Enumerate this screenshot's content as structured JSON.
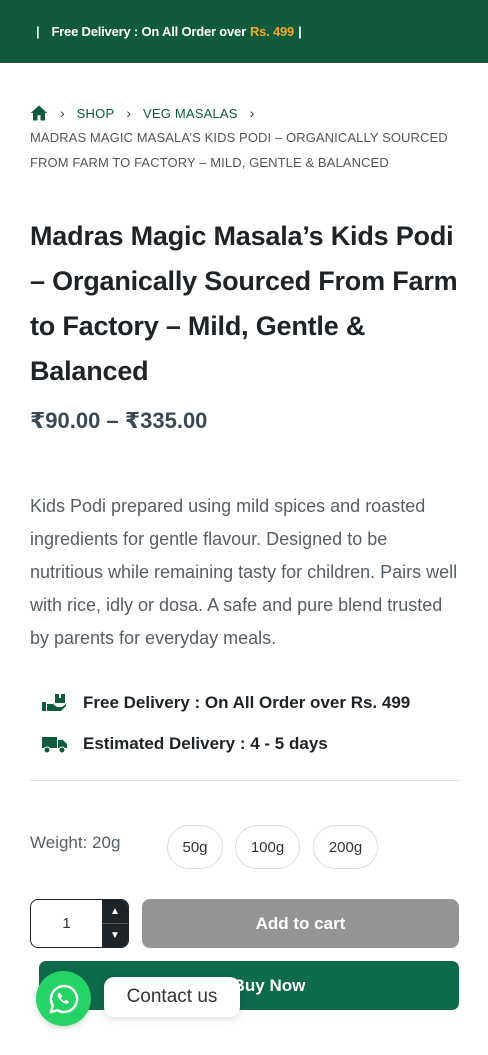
{
  "topbar": {
    "separator": "|",
    "text": "Free Delivery : On All Order over",
    "price": "Rs. 499",
    "separator_end": "|"
  },
  "breadcrumb": {
    "home_icon": "home-icon",
    "shop": "SHOP",
    "category": "VEG MASALAS",
    "current_line1": "MADRAS MAGIC MASALA’S KIDS PODI – ORGANICALLY SOURCED",
    "current_line2": "FROM FARM TO FACTORY – MILD, GENTLE & BALANCED"
  },
  "product": {
    "title": "Madras Magic Masala’s Kids Podi – Organically Sourced From Farm to Factory – Mild, Gentle & Balanced",
    "price_range": "₹90.00 – ₹335.00",
    "description": "Kids Podi prepared using mild spices and roasted ingredients for gentle flavour. Designed to be nutritious while remaining tasty for children. Pairs well with rice, idly or dosa. A safe and pure blend trusted by parents for everyday meals."
  },
  "perks": [
    {
      "icon": "delivery-hand-icon",
      "text": "Free Delivery : On All Order over Rs. 499"
    },
    {
      "icon": "truck-icon",
      "text": "Estimated Delivery : 4 - 5 days"
    }
  ],
  "variations": {
    "label": "Weight: 20g",
    "options": [
      "50g",
      "100g",
      "200g"
    ]
  },
  "cart": {
    "quantity": "1",
    "add_to_cart": "Add to cart",
    "buy_now": "Buy Now"
  },
  "chat": {
    "label": "Contact us",
    "icon": "whatsapp-icon"
  },
  "colors": {
    "brand_green": "#0f5b3c",
    "accent_orange": "#f5a623",
    "whatsapp_green": "#25d366"
  }
}
